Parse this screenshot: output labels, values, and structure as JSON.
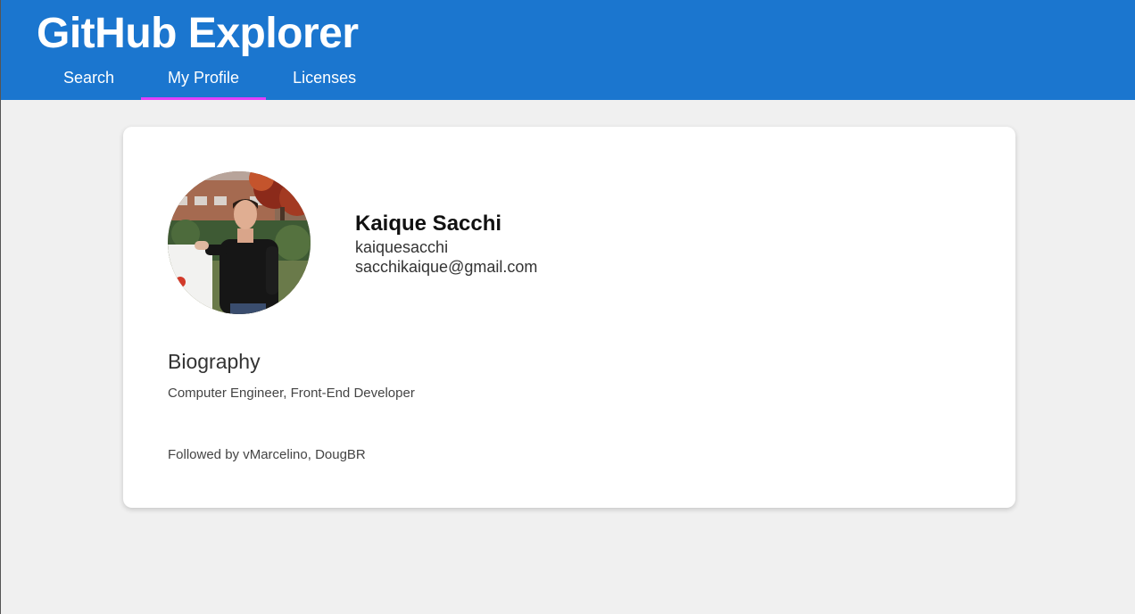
{
  "app": {
    "title": "GitHub Explorer",
    "accent_color": "#1b76cf",
    "tab_indicator_color": "#e040fb"
  },
  "tabs": [
    {
      "label": "Search",
      "active": false
    },
    {
      "label": "My Profile",
      "active": true
    },
    {
      "label": "Licenses",
      "active": false
    }
  ],
  "profile": {
    "name": "Kaique Sacchi",
    "login": "kaiquesacchi",
    "email": "sacchikaique@gmail.com",
    "avatar_icon": "profile-photo",
    "biography_heading": "Biography",
    "biography": "Computer Engineer, Front-End Developer",
    "followed_by": "Followed by vMarcelino, DougBR"
  }
}
